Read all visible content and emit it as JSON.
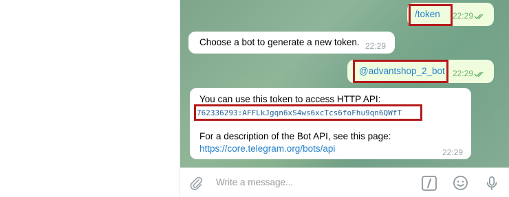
{
  "messages": {
    "cmd_token": {
      "text": "/token",
      "time": "22:29"
    },
    "bot_prompt": {
      "text": "Choose a bot to generate a new token.",
      "time": "22:29"
    },
    "bot_name": {
      "text": "@advantshop_2_bot",
      "time": "22:29"
    },
    "token_reply": {
      "line1": "You can use this token to access HTTP API:",
      "token": "762336293:AFFLkJgqn6xS4ws6xcTcs6foFhu9qn6QWfT",
      "line2": "For a description of the Bot API, see this page:",
      "link": "https://core.telegram.org/bots/api",
      "time": "22:29"
    }
  },
  "composer": {
    "placeholder": "Write a message..."
  },
  "icons": {
    "attach": "paperclip-icon",
    "commands": "slash-command-icon",
    "emoji": "smile-icon",
    "voice": "microphone-icon"
  },
  "colors": {
    "outgoing_bubble": "#effdde",
    "incoming_bubble": "#ffffff",
    "highlight": "#b51a1a",
    "link": "#2481cc",
    "read_checks": "#6cb26a"
  }
}
